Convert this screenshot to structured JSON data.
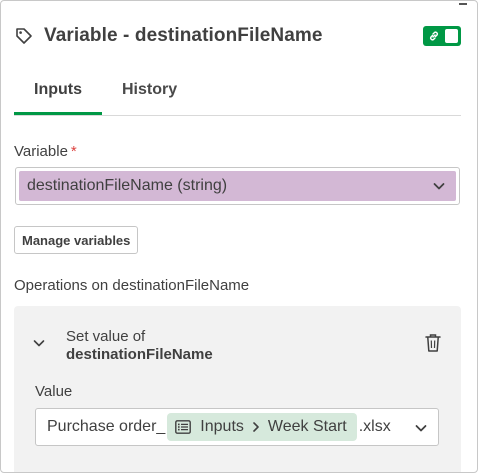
{
  "header": {
    "title": "Variable - destinationFileName",
    "icon": "tag-icon",
    "toggle_on": true,
    "toggle_color": "#009845"
  },
  "tabs": [
    {
      "label": "Inputs",
      "active": true
    },
    {
      "label": "History",
      "active": false
    }
  ],
  "variable_field": {
    "label": "Variable",
    "required_mark": "*",
    "selected": "destinationFileName (string)",
    "highlight_color": "#d3b8d5"
  },
  "manage_button": {
    "label": "Manage variables"
  },
  "operations": {
    "label": "Operations on destinationFileName",
    "items": [
      {
        "title_prefix": "Set value of",
        "title_var": "destinationFileName",
        "value_label": "Value",
        "value": {
          "prefix": "Purchase order_",
          "chip_source": "Inputs",
          "chip_field": "Week Start",
          "suffix": ".xlsx",
          "chip_color": "#d6e9dc"
        }
      }
    ]
  }
}
